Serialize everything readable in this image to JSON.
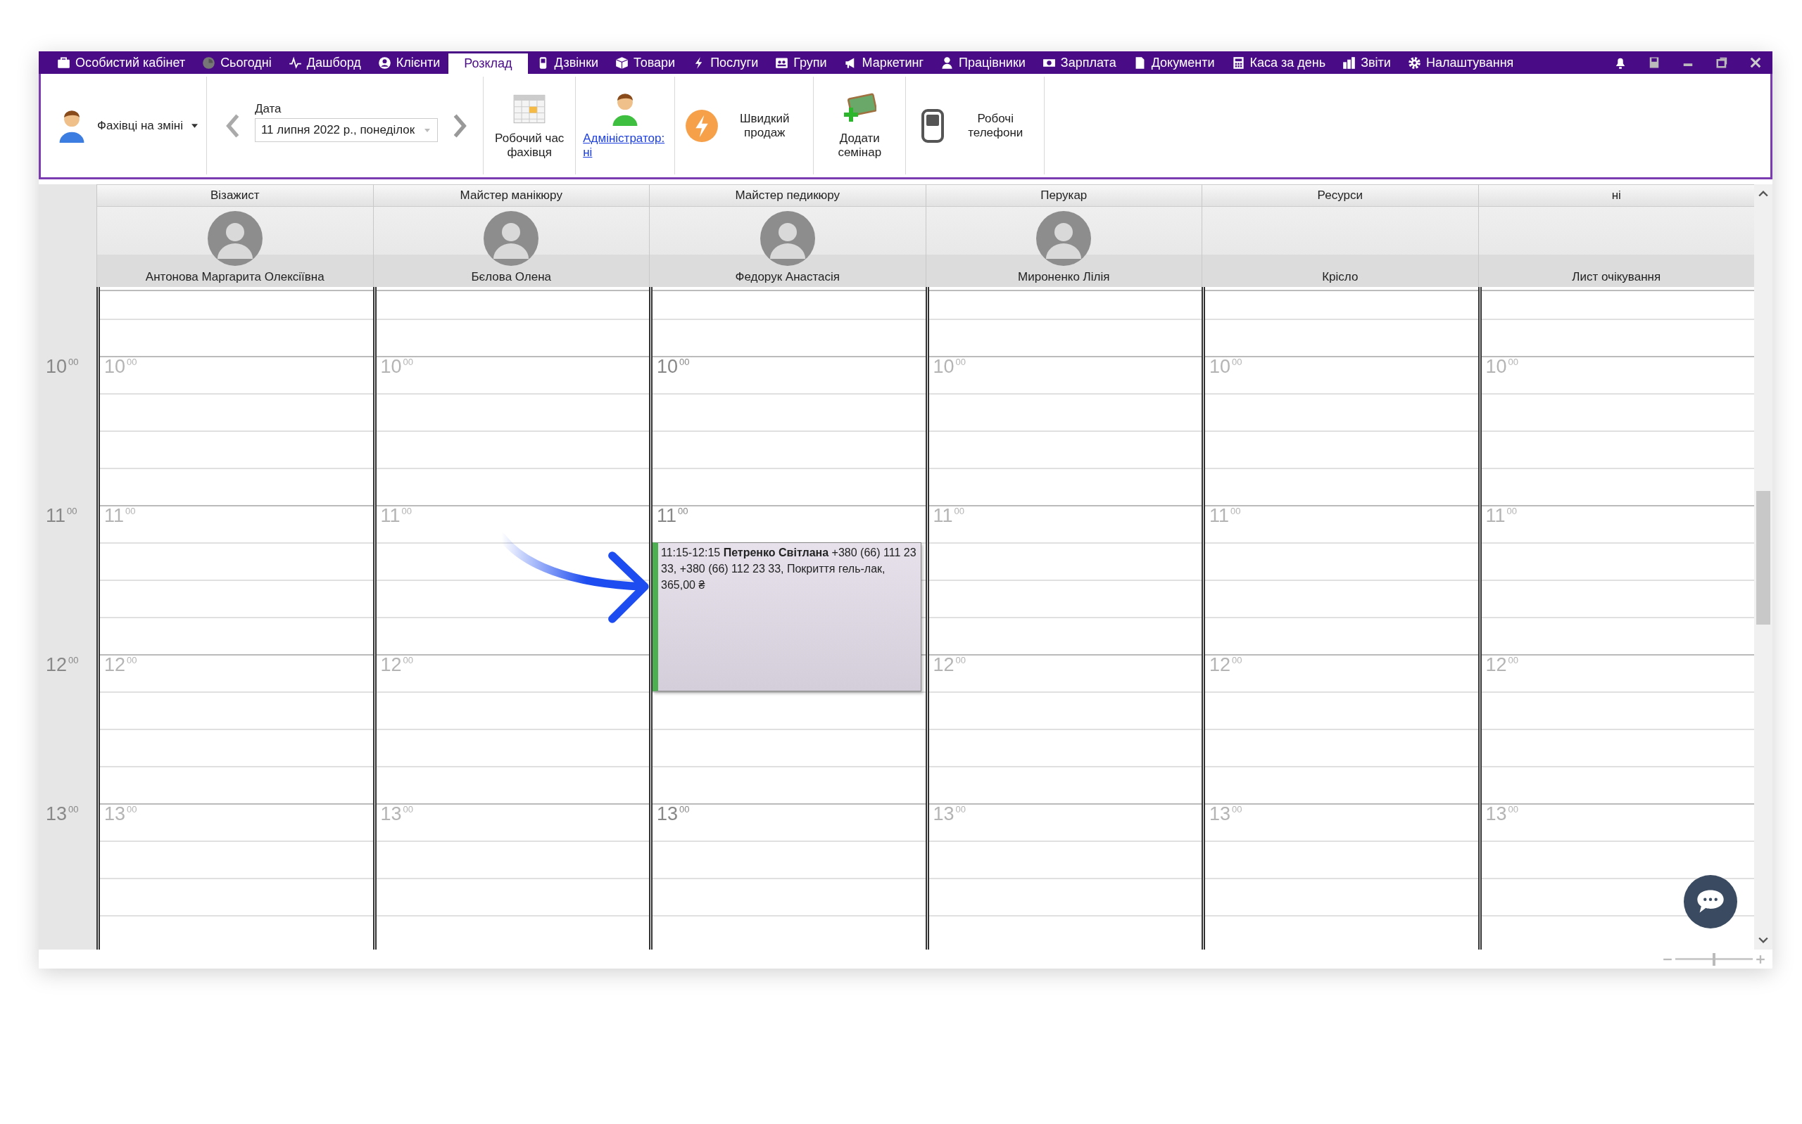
{
  "menu": [
    {
      "label": "Особистий кабінет",
      "selected": false
    },
    {
      "label": "Сьогодні",
      "selected": false
    },
    {
      "label": "Дашборд",
      "selected": false
    },
    {
      "label": "Клієнти",
      "selected": false
    },
    {
      "label": "Розклад",
      "selected": true
    },
    {
      "label": "Дзвінки",
      "selected": false
    },
    {
      "label": "Товари",
      "selected": false
    },
    {
      "label": "Послуги",
      "selected": false
    },
    {
      "label": "Групи",
      "selected": false
    },
    {
      "label": "Маркетинг",
      "selected": false
    },
    {
      "label": "Працівники",
      "selected": false
    },
    {
      "label": "Зарплата",
      "selected": false
    },
    {
      "label": "Документи",
      "selected": false
    },
    {
      "label": "Каса за день",
      "selected": false
    },
    {
      "label": "Звіти",
      "selected": false
    },
    {
      "label": "Налаштування",
      "selected": false
    }
  ],
  "toolbar": {
    "specialists": {
      "label": "Фахівці на зміні"
    },
    "date": {
      "label": "Дата",
      "value": "11 липня 2022 р., понеділок"
    },
    "buttons": [
      {
        "kind": "top",
        "label": "Робочий час фахівця"
      },
      {
        "kind": "link",
        "label": "Адміністратор: ні"
      },
      {
        "kind": "side",
        "label": "Швидкий продаж"
      },
      {
        "kind": "top",
        "label": "Додати семінар"
      },
      {
        "kind": "side",
        "label": "Робочі телефони"
      }
    ]
  },
  "time_gutter": [
    {
      "hour": "10",
      "minutes": "00"
    },
    {
      "hour": "11",
      "minutes": "00"
    },
    {
      "hour": "12",
      "minutes": "00"
    },
    {
      "hour": "13",
      "minutes": "00"
    }
  ],
  "columns": [
    {
      "role": "Візажист",
      "name": "Антонова Маргарита Олексіївна",
      "photo": true,
      "working_hours": false,
      "hour_marks": [
        {
          "hour": "10",
          "minutes": "00"
        },
        {
          "hour": "11",
          "minutes": "00"
        },
        {
          "hour": "12",
          "minutes": "00"
        },
        {
          "hour": "13",
          "minutes": "00"
        }
      ]
    },
    {
      "role": "Майстер манікюру",
      "name": "Бєлова Олена",
      "photo": true,
      "working_hours": false,
      "hour_marks": [
        {
          "hour": "10",
          "minutes": "00"
        },
        {
          "hour": "11",
          "minutes": "00"
        },
        {
          "hour": "12",
          "minutes": "00"
        },
        {
          "hour": "13",
          "minutes": "00"
        }
      ]
    },
    {
      "role": "Майстер педикюру",
      "name": "Федорук Анастасія",
      "photo": true,
      "working_hours": true,
      "hour_marks": [
        {
          "hour": "10",
          "minutes": "00"
        },
        {
          "hour": "11",
          "minutes": "00"
        },
        {
          "hour": "13",
          "minutes": "00"
        }
      ],
      "appointments": [
        {
          "time": "11:15-12:15",
          "client": "Петренко Світлана",
          "details": "+380 (66) 111 23 33, +380 (66) 112 23 33, Покриття гель-лак, 365,00 ₴",
          "color": "#4caf50"
        }
      ]
    },
    {
      "role": "Перукар",
      "name": "Мироненко Лілія",
      "photo": true,
      "working_hours": false,
      "hour_marks": [
        {
          "hour": "10",
          "minutes": "00"
        },
        {
          "hour": "11",
          "minutes": "00"
        },
        {
          "hour": "12",
          "minutes": "00"
        },
        {
          "hour": "13",
          "minutes": "00"
        }
      ]
    },
    {
      "role": "Ресурси",
      "name": "Крісло",
      "photo": false,
      "working_hours": false,
      "hour_marks": [
        {
          "hour": "10",
          "minutes": "00"
        },
        {
          "hour": "11",
          "minutes": "00"
        },
        {
          "hour": "12",
          "minutes": "00"
        },
        {
          "hour": "13",
          "minutes": "00"
        }
      ]
    },
    {
      "role": "ні",
      "name": "Лист очікування",
      "photo": false,
      "working_hours": false,
      "hour_marks": [
        {
          "hour": "10",
          "minutes": "00"
        },
        {
          "hour": "11",
          "minutes": "00"
        },
        {
          "hour": "12",
          "minutes": "00"
        },
        {
          "hour": "13",
          "minutes": "00"
        }
      ]
    }
  ],
  "zoom": {
    "level": 0.5
  }
}
